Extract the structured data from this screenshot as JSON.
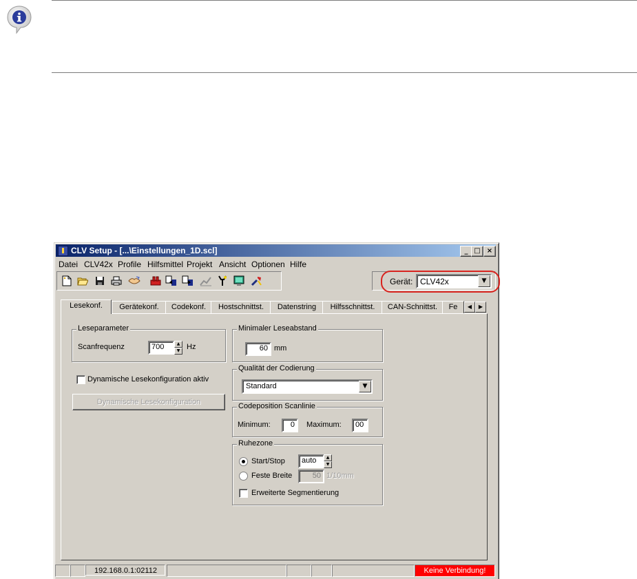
{
  "window": {
    "title": "CLV Setup - [...\\Einstellungen_1D.scl]",
    "controls": {
      "minimize": "_",
      "maximize": "□",
      "close": "×"
    }
  },
  "menu": [
    "Datei",
    "CLV42x",
    "Profile",
    "Hilfsmittel",
    "Projekt",
    "Ansicht",
    "Optionen",
    "Hilfe"
  ],
  "toolbar": {
    "icons": [
      "new-icon",
      "open-icon",
      "save-icon",
      "print-icon",
      "handshake-icon",
      "device-icon",
      "upload-icon",
      "download-icon",
      "chart-icon",
      "tools-icon",
      "monitor-icon",
      "wrench-icon"
    ],
    "device_label": "Gerät:",
    "device_value": "CLV42x"
  },
  "tabs": [
    "Lesekonf.",
    "Gerätekonf.",
    "Codekonf.",
    "Hostschnittst.",
    "Datenstring",
    "Hilfsschnittst.",
    "CAN-Schnittst.",
    "Fe"
  ],
  "leseparameter": {
    "title": "Leseparameter",
    "scanfrequenz_label": "Scanfrequenz",
    "scanfrequenz_value": "700",
    "unit": "Hz"
  },
  "dynamic": {
    "checkbox_label": "Dynamische Lesekonfiguration aktiv",
    "button_label": "Dynamische Lesekonfiguration"
  },
  "min_leseabstand": {
    "title": "Minimaler Leseabstand",
    "value": "60",
    "unit": "mm"
  },
  "qualitaet": {
    "title": "Qualität der Codierung",
    "value": "Standard"
  },
  "codeposition": {
    "title": "Codeposition Scanlinie",
    "min_label": "Minimum:",
    "min_value": "0",
    "max_label": "Maximum:",
    "max_value": "00"
  },
  "ruhezone": {
    "title": "Ruhezone",
    "startstop_label": "Start/Stop",
    "startstop_value": "auto",
    "feste_label": "Feste Breite",
    "feste_value": "50",
    "feste_unit": "1/10mm",
    "segment_label": "Erweiterte Segmentierung"
  },
  "status": {
    "address": "192.168.0.1:02112",
    "connection": "Keine Verbindung!",
    "connection_color": "#ff0000"
  },
  "colors": {
    "title_start": "#0a246a",
    "title_end": "#a6caf0",
    "highlight": "#d8231e",
    "info_icon": "#2a3c9c"
  }
}
